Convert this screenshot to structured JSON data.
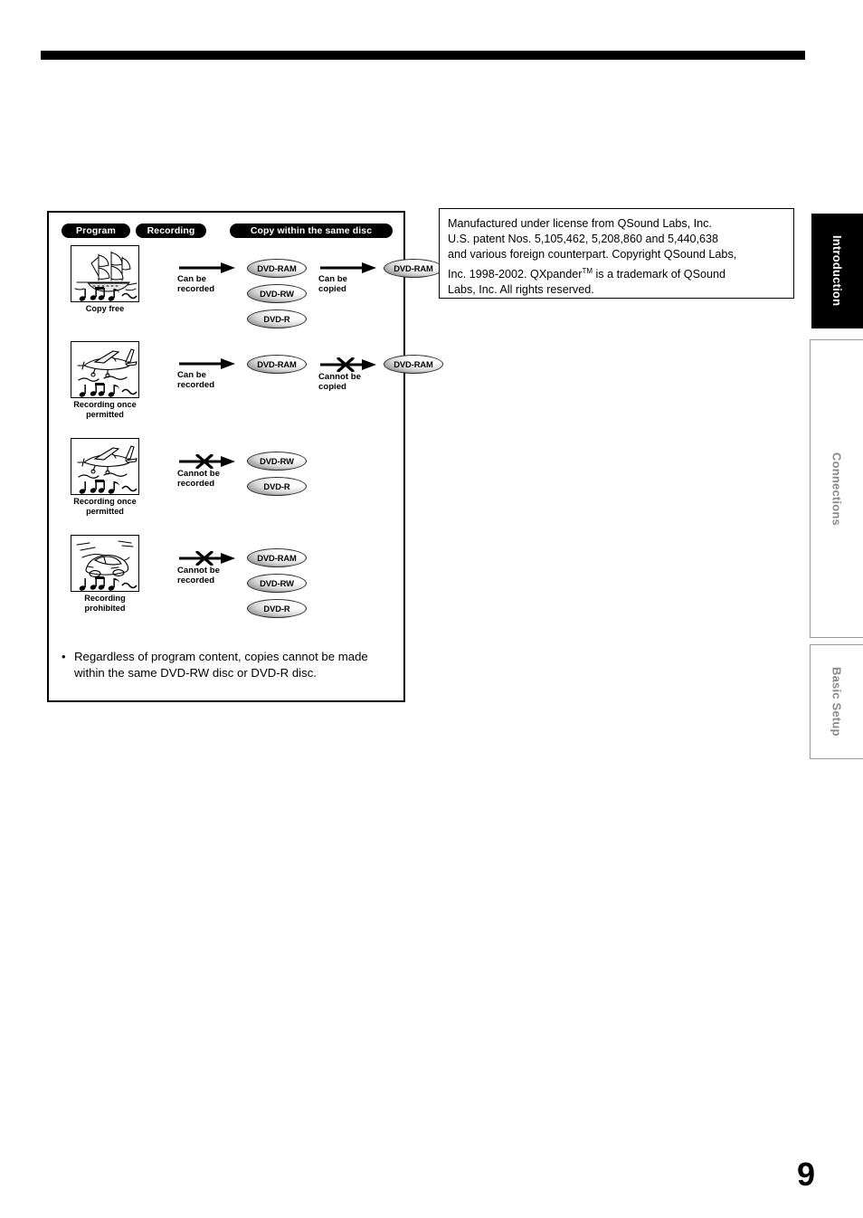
{
  "page": {
    "number": "9"
  },
  "diagram": {
    "headers": [
      {
        "label": "Program"
      },
      {
        "label": "Recording"
      },
      {
        "label": "Copy within the same disc"
      }
    ],
    "rows": [
      {
        "program_icon": "sailing-ship-icon",
        "program_caption": "Copy free",
        "record_label": "Can be\nrecorded",
        "record_blocked": false,
        "record_discs": [
          "DVD-RAM",
          "DVD-RW",
          "DVD-R"
        ],
        "copy_label": "Can be\ncopied",
        "copy_blocked": false,
        "copy_discs": [
          "DVD-RAM"
        ]
      },
      {
        "program_icon": "airplane-icon",
        "program_caption": "Recording once\npermitted",
        "record_label": "Can be\nrecorded",
        "record_blocked": false,
        "record_discs": [
          "DVD-RAM"
        ],
        "copy_label": "Cannot be\ncopied",
        "copy_blocked": true,
        "copy_discs": [
          "DVD-RAM"
        ]
      },
      {
        "program_icon": "airplane-icon",
        "program_caption": "Recording once\npermitted",
        "record_label": "Cannot be\nrecorded",
        "record_blocked": true,
        "record_discs": [
          "DVD-RW",
          "DVD-R"
        ],
        "copy_label": "",
        "copy_blocked": false,
        "copy_discs": []
      },
      {
        "program_icon": "car-icon",
        "program_caption": "Recording\nprohibited",
        "record_label": "Cannot be\nrecorded",
        "record_blocked": true,
        "record_discs": [
          "DVD-RAM",
          "DVD-RW",
          "DVD-R"
        ],
        "copy_label": "",
        "copy_blocked": false,
        "copy_discs": []
      }
    ],
    "note": {
      "bullet": "•",
      "text": "Regardless of program content, copies cannot be made within the same DVD-RW disc or DVD-R disc."
    }
  },
  "license": {
    "line1": "Manufactured under license from QSound Labs, Inc.",
    "line2": "U.S. patent Nos. 5,105,462, 5,208,860 and 5,440,638",
    "line3": "and various foreign counterpart. Copyright QSound Labs,",
    "line4_a": "Inc. 1998-2002. QXpander",
    "line4_sup": "TM",
    "line4_b": " is a trademark of QSound",
    "line5": "Labs, Inc. All rights reserved."
  },
  "side_tabs": [
    {
      "label": "Introduction",
      "active": true
    },
    {
      "label": "Connections",
      "active": false
    },
    {
      "label": "Basic Setup",
      "active": false
    }
  ],
  "colors": {
    "ink": "#000000",
    "tab_inactive_border": "#9a9a9a",
    "tab_inactive_text": "#8a8a8a",
    "disc_gradient_dark": "#6a6a6a"
  }
}
